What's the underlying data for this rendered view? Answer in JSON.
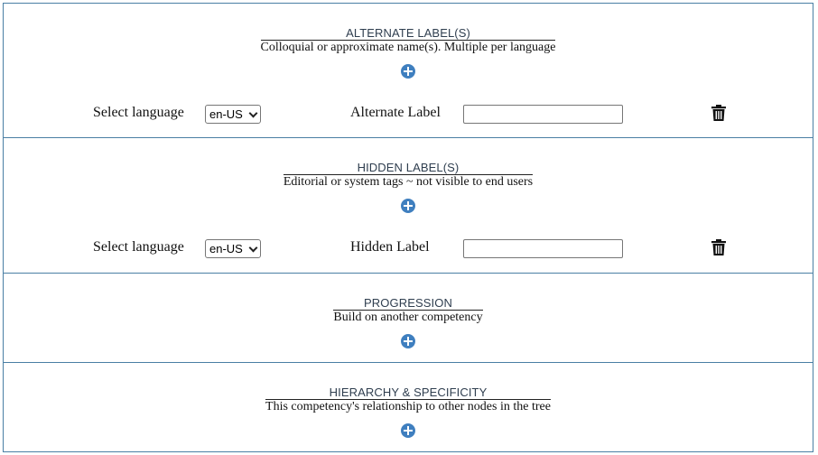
{
  "sections": {
    "alternate": {
      "title": "ALTERNATE LABEL(S)",
      "subtitle": "Colloquial or approximate name(s). Multiple per language",
      "row": {
        "language_label": "Select language",
        "language_value": "en-US",
        "field_label": "Alternate Label",
        "field_value": ""
      }
    },
    "hidden": {
      "title": "HIDDEN LABEL(S)",
      "subtitle": "Editorial or system tags ~ not visible to end users",
      "row": {
        "language_label": "Select language",
        "language_value": "en-US",
        "field_label": "Hidden Label",
        "field_value": ""
      }
    },
    "progression": {
      "title": "PROGRESSION",
      "subtitle": "Build on another competency"
    },
    "hierarchy": {
      "title": "HIERARCHY & SPECIFICITY",
      "subtitle": "This competency's relationship to other nodes in the tree"
    }
  },
  "icons": {
    "add": "plus-circle-icon",
    "delete": "trash-icon"
  },
  "colors": {
    "border": "#4a7fa4",
    "add_button": "#3f7fbf"
  }
}
